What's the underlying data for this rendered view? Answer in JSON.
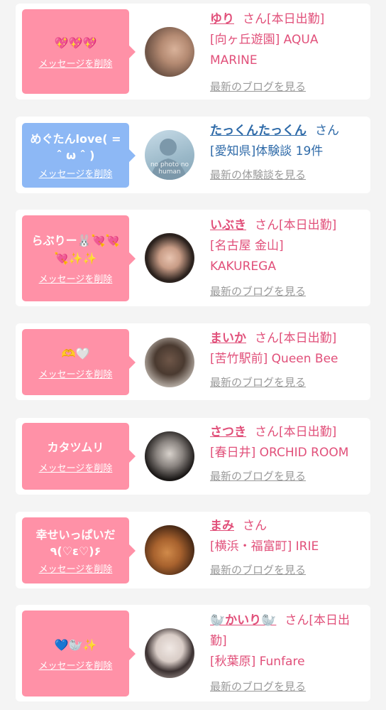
{
  "entries": [
    {
      "bubble_text": "💖💖💖",
      "bubble_color": "#ff91a7",
      "delete_label": "メッセージを削除",
      "name": "ゆり",
      "honorific": "さん[本日出勤]",
      "shop": "[向ヶ丘遊園] AQUA MARINE",
      "blog_link": "最新のブログを見る",
      "avatar": "photo"
    },
    {
      "bubble_text": "めぐたんlove( = ˆ ω ˆ )",
      "bubble_color": "#8db8f5",
      "delete_label": "メッセージを削除",
      "name": "たっくんたっくん",
      "honorific": "さん",
      "shop": "[愛知県]体験談 19件",
      "blog_link": "最新の体験談を見る",
      "avatar": "no photo",
      "avatar_text": "no photo no human"
    },
    {
      "bubble_text": "らぶりー🐰💘💘💘✨✨",
      "bubble_color": "#ff91a7",
      "delete_label": "メッセージを削除",
      "name": "いぶき",
      "honorific": "さん[本日出勤]",
      "shop": "[名古屋 金山] KAKUREGA",
      "blog_link": "最新のブログを見る",
      "avatar": "photo"
    },
    {
      "bubble_text": "🫶🤍",
      "bubble_color": "#ff91a7",
      "delete_label": "メッセージを削除",
      "name": "まいか",
      "honorific": "さん[本日出勤]",
      "shop": "[苦竹駅前] Queen Bee",
      "blog_link": "最新のブログを見る",
      "avatar": "photo"
    },
    {
      "bubble_text": "カタツムリ",
      "bubble_color": "#ff91a7",
      "delete_label": "メッセージを削除",
      "name": "さつき",
      "honorific": "さん[本日出勤]",
      "shop": "[春日井] ORCHID ROOM",
      "blog_link": "最新のブログを見る",
      "avatar": "photo"
    },
    {
      "bubble_text": "幸せいっぱいだ٩(♡ε♡)۶",
      "bubble_color": "#ff91a7",
      "delete_label": "メッセージを削除",
      "name": "まみ",
      "honorific": "さん",
      "shop": "[横浜・福富町] IRIE",
      "blog_link": "最新のブログを見る",
      "avatar": "photo"
    },
    {
      "bubble_text": "💙🦭✨",
      "bubble_color": "#ff91a7",
      "delete_label": "メッセージを削除",
      "name": "🦭かいり🦭",
      "honorific": "さん[本日出勤]",
      "shop": "[秋葉原] Funfare",
      "blog_link": "最新のブログを見る",
      "avatar": "photo"
    }
  ],
  "colors": {
    "accent_pink": "#e1507a",
    "link_blue": "#2e6aa8",
    "bubble_pink": "#ff91a7",
    "bubble_blue": "#8db8f5",
    "link_gray": "#9a9a9a"
  }
}
